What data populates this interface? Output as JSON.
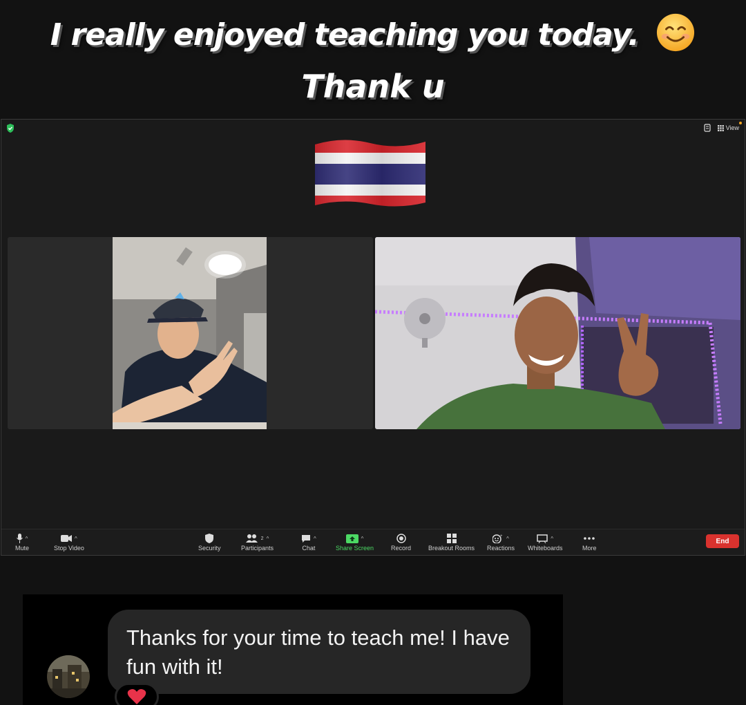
{
  "caption": {
    "line1": "I really enjoyed teaching you today.",
    "line2": "Thank u",
    "emoji": "smiling-face-icon"
  },
  "meeting": {
    "view_label": "View",
    "flag": "thailand-flag",
    "participants_count": "2",
    "toolbar": {
      "mute": "Mute",
      "stop_video": "Stop Video",
      "security": "Security",
      "participants": "Participants",
      "chat": "Chat",
      "share_screen": "Share Screen",
      "record": "Record",
      "breakout_rooms": "Breakout Rooms",
      "reactions": "Reactions",
      "whiteboards": "Whiteboards",
      "more": "More",
      "end": "End"
    },
    "colors": {
      "share_green": "#4cd964",
      "end_red": "#d9322e",
      "security_green": "#2dbf5a"
    }
  },
  "message": {
    "text": "Thanks for your time to teach me! I have fun with it!",
    "reaction": "heart-icon"
  }
}
